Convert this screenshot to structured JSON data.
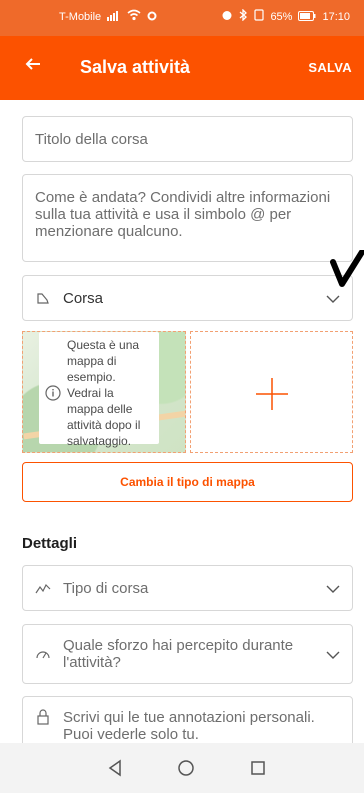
{
  "status_bar": {
    "carrier": "T-Mobile",
    "signal": "📶",
    "wifi": "📶",
    "dot": "●",
    "right_icons": "⏰ ✱ ▙",
    "battery": "65%",
    "time": "17:10"
  },
  "app_bar": {
    "back_icon": "←",
    "title": "Salva attività",
    "save_label": "SALVA"
  },
  "form": {
    "title_placeholder": "Titolo della corsa",
    "description_placeholder": "Come è andata? Condividi altre informazioni sulla tua attività e usa il simbolo @ per menzionare qualcuno.",
    "sport_label": "Corsa",
    "map_info": "Questa è una mappa di esempio. Vedrai la mappa delle attività dopo il salvataggio.",
    "map_button": "Cambia il tipo di mappa",
    "details_heading": "Dettagli",
    "run_type_placeholder": "Tipo di corsa",
    "effort_placeholder": "Quale sforzo hai percepito durante l'attività?",
    "notes_placeholder": "Scrivi qui le tue annotazioni personali. Puoi vederle solo tu."
  },
  "colors": {
    "brand": "#fc5200",
    "status": "#ef6a2a"
  }
}
